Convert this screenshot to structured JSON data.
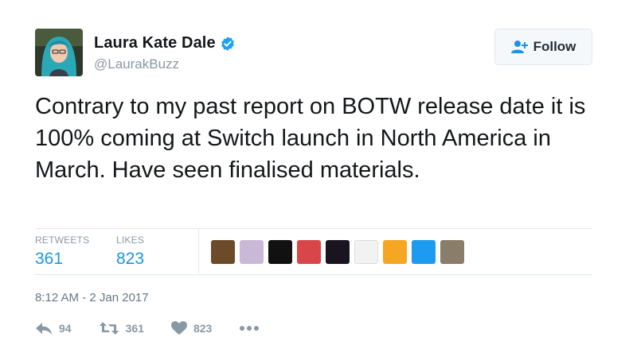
{
  "user": {
    "name": "Laura Kate Dale",
    "handle": "@LaurakBuzz",
    "verified_icon": "verified-badge-icon"
  },
  "follow_button": {
    "label": "Follow",
    "icon": "add-user-icon"
  },
  "tweet": {
    "text": "Contrary to my past report on BOTW release date it is 100% coming at Switch launch in North America in March. Have seen finalised materials."
  },
  "stats": {
    "retweets_label": "RETWEETS",
    "retweets_value": "361",
    "likes_label": "LIKES",
    "likes_value": "823"
  },
  "likers": [
    {
      "color": "#6b4b2a"
    },
    {
      "color": "#c9b8d8"
    },
    {
      "color": "#111111"
    },
    {
      "color": "#d9464a"
    },
    {
      "color": "#1a1420"
    },
    {
      "color": "#f2f2f2"
    },
    {
      "color": "#f5a623"
    },
    {
      "color": "#1d9bf0"
    },
    {
      "color": "#8a7d6a"
    }
  ],
  "timestamp": "8:12 AM - 2 Jan 2017",
  "actions": {
    "reply_count": "94",
    "retweet_count": "361",
    "like_count": "823"
  },
  "colors": {
    "accent": "#1b95e0",
    "muted": "#8899a6",
    "border": "#e1e8ed"
  }
}
